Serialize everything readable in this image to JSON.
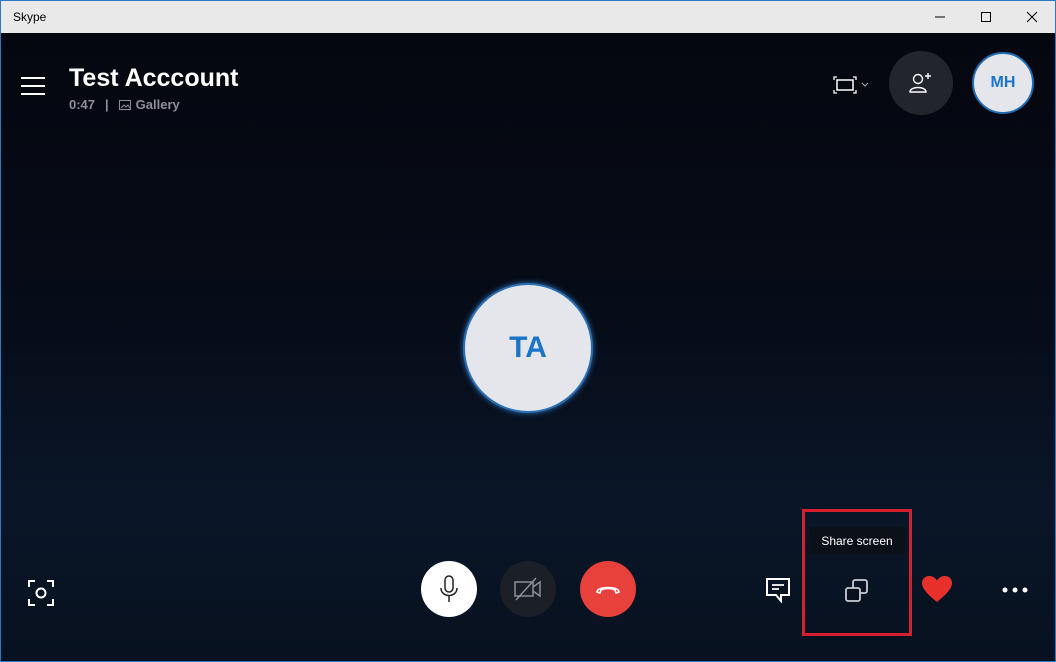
{
  "window": {
    "title": "Skype",
    "controls": {
      "minimize": "minimize",
      "maximize": "maximize",
      "close": "close"
    }
  },
  "call": {
    "name": "Test Acccount",
    "duration": "0:47",
    "separator": "|",
    "view_mode": "Gallery"
  },
  "header": {
    "menu_icon": "hamburger-icon",
    "layout_icon": "fullscreen-frame-icon",
    "add_participant_icon": "add-person-icon",
    "self_avatar_initials": "MH"
  },
  "participant": {
    "initials": "TA"
  },
  "controls": {
    "snapshot_icon": "camera-snapshot-icon",
    "mic_icon": "microphone-icon",
    "video_icon": "video-off-icon",
    "hangup_icon": "hangup-icon",
    "chat_icon": "chat-icon",
    "share_icon": "share-screen-icon",
    "react_icon": "heart-icon",
    "more_icon": "more-icon",
    "share_tooltip": "Share screen"
  },
  "colors": {
    "accent": "#1a75c9",
    "hangup": "#e8403a",
    "heart": "#e8302b",
    "highlight": "#d6202f"
  }
}
